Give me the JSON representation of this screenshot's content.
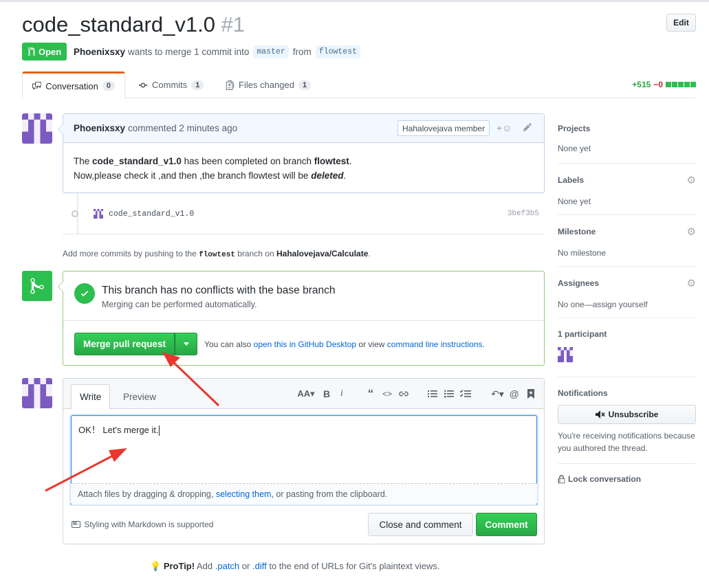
{
  "pr": {
    "title": "code_standard_v1.0",
    "number": "#1",
    "edit_label": "Edit",
    "state_label": "Open",
    "author": "Phoenixsxy",
    "merge_text_1": "wants to merge 1 commit into",
    "base_branch": "master",
    "from_text": "from",
    "head_branch": "flowtest"
  },
  "tabs": [
    {
      "label": "Conversation",
      "count": "0",
      "icon": "comment-discussion-icon"
    },
    {
      "label": "Commits",
      "count": "1",
      "icon": "git-commit-icon"
    },
    {
      "label": "Files changed",
      "count": "1",
      "icon": "file-diff-icon"
    }
  ],
  "diffstat": {
    "additions": "+515",
    "deletions": "−0"
  },
  "comment": {
    "author": "Phoenixsxy",
    "action": "commented",
    "time": "2 minutes ago",
    "badge": "Hahalovejava member",
    "line1_pre": "The",
    "line1_bold": "code_standard_v1.0",
    "line1_mid": "has been completed on branch",
    "line1_branch": "flowtest",
    "line1_end": ".",
    "line2_pre": "Now,please check it ,and then ,the branch flowtest will be",
    "line2_emph": "deleted",
    "line2_end": "."
  },
  "commit": {
    "message": "code_standard_v1.0",
    "sha": "3bef3b5"
  },
  "push_note": {
    "pre": "Add more commits by pushing to the",
    "branch": "flowtest",
    "mid": "branch on",
    "repo": "Hahalovejava/Calculate",
    "end": "."
  },
  "merge": {
    "title": "This branch has no conflicts with the base branch",
    "subtitle": "Merging can be performed automatically.",
    "button": "Merge pull request",
    "alt_pre": "You can also",
    "alt_link1": "open this in GitHub Desktop",
    "alt_mid": "or view",
    "alt_link2": "command line instructions",
    "alt_end": "."
  },
  "editor": {
    "tab_write": "Write",
    "tab_preview": "Preview",
    "text": "OK！ Let's merge it.",
    "attach_pre": "Attach files by dragging & dropping,",
    "attach_link": "selecting them",
    "attach_post": ", or pasting from the clipboard.",
    "markdown_note": "Styling with Markdown is supported",
    "close_button": "Close and comment",
    "comment_button": "Comment"
  },
  "protip": {
    "label": "ProTip!",
    "pre": "Add",
    "patch": ".patch",
    "or": "or",
    "diff": ".diff",
    "post": "to the end of URLs for Git's plaintext views."
  },
  "sidebar": {
    "projects": {
      "title": "Projects",
      "value": "None yet"
    },
    "labels": {
      "title": "Labels",
      "value": "None yet"
    },
    "milestone": {
      "title": "Milestone",
      "value": "No milestone"
    },
    "assignees": {
      "title": "Assignees",
      "value": "No one—assign yourself"
    },
    "participants": {
      "title": "1 participant"
    },
    "notifications": {
      "title": "Notifications",
      "button": "Unsubscribe",
      "note": "You're receiving notifications because you authored the thread."
    },
    "lock": "Lock conversation"
  },
  "colors": {
    "open_green": "#2cbe4e",
    "link_blue": "#0366d6",
    "annotation_red": "#e8372d",
    "avatar_purple": "#7b5bc1"
  }
}
